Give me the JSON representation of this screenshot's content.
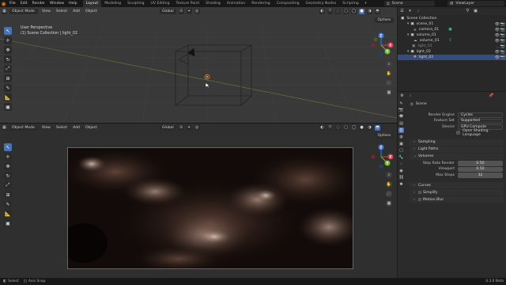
{
  "topbar": {
    "menus": [
      "File",
      "Edit",
      "Render",
      "Window",
      "Help"
    ],
    "workspaces": [
      "Layout",
      "Modeling",
      "Sculpting",
      "UV Editing",
      "Texture Paint",
      "Shading",
      "Animation",
      "Rendering",
      "Compositing",
      "Geometry Nodes",
      "Scripting"
    ],
    "active_workspace": "Layout",
    "scene_name": "Scene",
    "view_layer": "ViewLayer"
  },
  "viewport_top": {
    "mode": "Object Mode",
    "menus": [
      "View",
      "Select",
      "Add",
      "Object"
    ],
    "transform": "Global",
    "info_line1": "User Perspective",
    "info_line2": "(1) Scene Collection | light_02",
    "options_label": "Options"
  },
  "viewport_bottom": {
    "mode": "Object Mode",
    "menus": [
      "View",
      "Select",
      "Add",
      "Object"
    ],
    "transform": "Global",
    "options_label": "Options"
  },
  "outliner": {
    "root": "Scene Collection",
    "items": [
      {
        "label": "scene_01",
        "indent": 1,
        "selected": false
      },
      {
        "label": "camera_01",
        "indent": 2,
        "selected": false
      },
      {
        "label": "volume_01",
        "indent": 1,
        "selected": false
      },
      {
        "label": "volume_01",
        "indent": 2,
        "selected": false
      },
      {
        "label": "light_01",
        "indent": 1,
        "selected": false
      },
      {
        "label": "light_02",
        "indent": 1,
        "selected": false
      },
      {
        "label": "light_02",
        "indent": 2,
        "selected": true
      }
    ]
  },
  "properties": {
    "header": "Scene",
    "render_engine_label": "Render Engine",
    "render_engine": "Cycles",
    "feature_set_label": "Feature Set",
    "feature_set": "Supported",
    "device_label": "Device",
    "device": "GPU Compute",
    "osl_label": "Open Shading Language",
    "sections": {
      "sampling": "Sampling",
      "light_paths": "Light Paths",
      "volumes": "Volumes",
      "curves": "Curves",
      "simplify": "Simplify",
      "motion_blur": "Motion Blur"
    },
    "step_rate_render_label": "Step Rate Render",
    "step_rate_render": "0.50",
    "viewport_label": "Viewport",
    "viewport_value": "0.50",
    "max_steps_label": "Max Steps",
    "max_steps": "32"
  },
  "statusbar": {
    "item1": "Select",
    "item2": "Axis Snap",
    "version": "4.3.0 Beta"
  },
  "colors": {
    "accent_blue": "#4772b3",
    "selection": "#334d80",
    "blender_orange": "#e87d0d"
  }
}
